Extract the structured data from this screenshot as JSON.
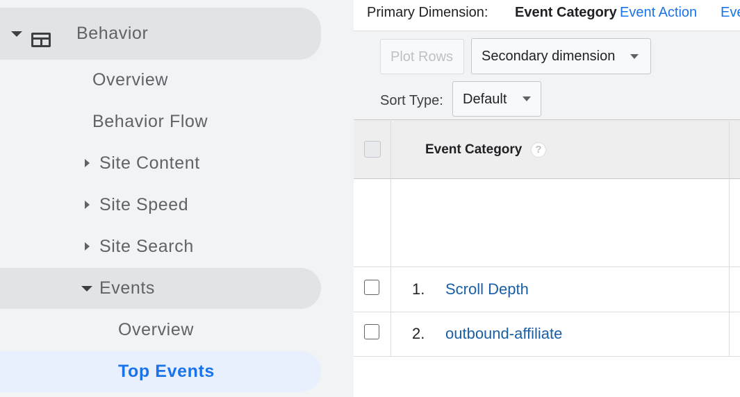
{
  "sidebar": {
    "behavior_label": "Behavior",
    "items": [
      {
        "label": "Overview"
      },
      {
        "label": "Behavior Flow"
      },
      {
        "label": "Site Content"
      },
      {
        "label": "Site Speed"
      },
      {
        "label": "Site Search"
      },
      {
        "label": "Events"
      },
      {
        "label": "Overview"
      },
      {
        "label": "Top Events"
      }
    ]
  },
  "dimension_bar": {
    "label": "Primary Dimension:",
    "active": "Event Category",
    "links": [
      "Event Action",
      "Eve"
    ]
  },
  "toolbar": {
    "plot_rows_label": "Plot Rows",
    "secondary_dimension_label": "Secondary dimension",
    "sort_type_label": "Sort Type:",
    "sort_type_value": "Default"
  },
  "table": {
    "column_header": "Event Category",
    "help_symbol": "?",
    "rows": [
      {
        "index": "1.",
        "label": "Scroll Depth"
      },
      {
        "index": "2.",
        "label": "outbound-affiliate"
      }
    ]
  },
  "colors": {
    "link": "#1a73e8",
    "active_nav": "#1a73e8",
    "sidebar_bg": "#f1f3f4"
  }
}
